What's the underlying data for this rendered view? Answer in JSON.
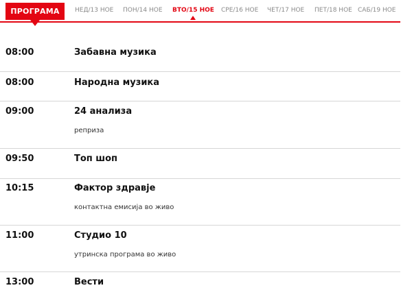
{
  "header": {
    "program_label": "ПРОГРАМА",
    "days": [
      {
        "label": "НЕД/13 НОЕ",
        "active": false
      },
      {
        "label": "ПОН/14 НОЕ",
        "active": false
      },
      {
        "label": "ВТО/15 НОЕ",
        "active": true
      },
      {
        "label": "СРЕ/16 НОЕ",
        "active": false
      },
      {
        "label": "ЧЕТ/17 НОЕ",
        "active": false
      },
      {
        "label": "ПЕТ/18 НОЕ",
        "active": false
      },
      {
        "label": "САБ/19 НОЕ",
        "active": false
      }
    ],
    "accent_color": "#e30613"
  },
  "schedule": [
    {
      "time": "08:00",
      "title": "Забавна музика",
      "description": ""
    },
    {
      "time": "08:00",
      "title": "Народна музика",
      "description": ""
    },
    {
      "time": "09:00",
      "title": "24 анализа",
      "description": "реприза"
    },
    {
      "time": "09:50",
      "title": "Топ шоп",
      "description": ""
    },
    {
      "time": "10:15",
      "title": "Фактор здравје",
      "description": "контактна емисија во живо"
    },
    {
      "time": "11:00",
      "title": "Студио 10",
      "description": "утринска програма во живо"
    },
    {
      "time": "13:00",
      "title": "Вести",
      "description": ""
    }
  ]
}
